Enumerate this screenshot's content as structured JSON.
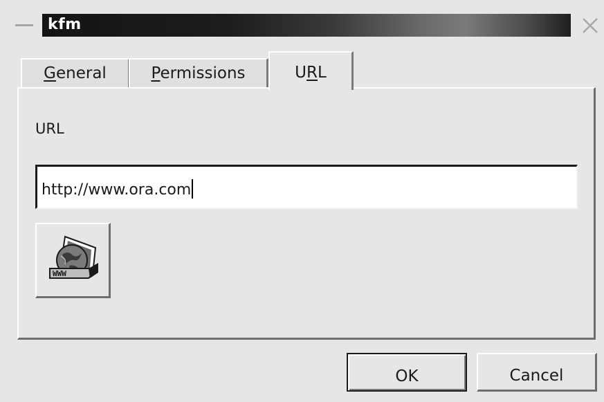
{
  "window": {
    "title": "kfm"
  },
  "tabs": [
    {
      "label_underlined": "G",
      "label_rest": "eneral"
    },
    {
      "label_underlined": "P",
      "label_rest": "ermissions"
    },
    {
      "label_before": "U",
      "label_underlined": "R",
      "label_rest": "L"
    }
  ],
  "active_tab": "URL",
  "url_page": {
    "label": "URL",
    "url_value": "http://www.ora.com",
    "icon": "www-globe-icon"
  },
  "buttons": {
    "ok_label": "OK",
    "cancel_label": "Cancel"
  },
  "colors": {
    "background": "#e6e6e6",
    "title_bar": "#141414",
    "title_text": "#ffffff"
  }
}
